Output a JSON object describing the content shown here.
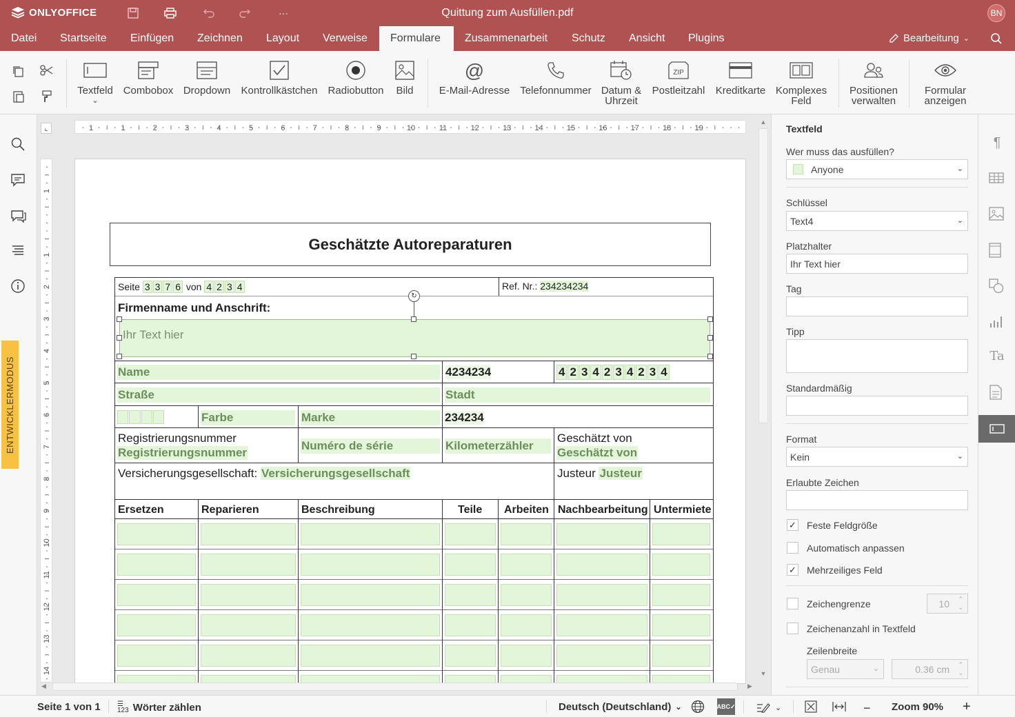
{
  "app": {
    "name": "ONLYOFFICE",
    "doc_title": "Quittung zum Ausfüllen.pdf",
    "user_initials": "BN"
  },
  "menu": {
    "items": [
      "Datei",
      "Startseite",
      "Einfügen",
      "Zeichnen",
      "Layout",
      "Verweise",
      "Formulare",
      "Zusammenarbeit",
      "Schutz",
      "Ansicht",
      "Plugins"
    ],
    "active": "Formulare",
    "edit_mode": "Bearbeitung"
  },
  "ribbon": {
    "textfield": "Textfeld",
    "combobox": "Combobox",
    "dropdown": "Dropdown",
    "checkbox": "Kontrollkästchen",
    "radio": "Radiobutton",
    "image": "Bild",
    "email": "E-Mail-Adresse",
    "phone": "Telefonnummer",
    "date_l1": "Datum &",
    "date_l2": "Uhrzeit",
    "zip": "Postleitzahl",
    "credit": "Kreditkarte",
    "complex_l1": "Komplexes",
    "complex_l2": "Feld",
    "roles_l1": "Positionen",
    "roles_l2": "verwalten",
    "view_l1": "Formular",
    "view_l2": "anzeigen"
  },
  "left": {
    "devmode": "ENTWICKLERMODUS"
  },
  "ruler": {
    "h_labels": [
      "1",
      "1",
      "2",
      "3",
      "4",
      "5",
      "6",
      "7",
      "8",
      "9",
      "10",
      "11",
      "12",
      "13",
      "14",
      "15",
      "16",
      "17",
      "18",
      "19"
    ],
    "v_labels": [
      "1",
      "1",
      "2",
      "3",
      "4",
      "5",
      "6",
      "7",
      "8",
      "9",
      "10",
      "11",
      "12",
      "13",
      "14"
    ]
  },
  "form": {
    "title": "Geschätzte Autoreparaturen",
    "page_label": "Seite",
    "page_digits": [
      "3",
      "3",
      "7",
      "6"
    ],
    "of_label": "von",
    "of_digits": [
      "4",
      "2",
      "3",
      "4"
    ],
    "ref_label": "Ref. Nr.:",
    "ref_value": "234234234",
    "company_label": "Firmenname und Anschrift:",
    "company_placeholder": "Ihr Text hier",
    "name": "Name",
    "name_value": "4234234",
    "name_digits": [
      "4",
      "2",
      "3",
      "4",
      "2",
      "3",
      "4",
      "2",
      "3",
      "4"
    ],
    "street": "Straße",
    "city": "Stadt",
    "color": "Farbe",
    "brand": "Marke",
    "brand_value": "234234",
    "reg_label": "Registrierungsnummer",
    "reg_field": "Registrierungsnummer",
    "serial": "Numéro de série",
    "km": "Kilometerzähler",
    "est_label": "Geschätzt von",
    "est_field": "Geschätzt von",
    "ins_label": "Versicherungsgesellschaft:",
    "ins_field": "Versicherungsgesellschaft",
    "adj_label": "Justeur",
    "adj_field": "Justeur",
    "cols": [
      "Ersetzen",
      "Reparieren",
      "Beschreibung",
      "Teile",
      "Arbeiten",
      "Nachbearbeitung",
      "Untermiete"
    ]
  },
  "panel": {
    "title": "Textfeld",
    "who_label": "Wer muss das ausfüllen?",
    "who_value": "Anyone",
    "key_label": "Schlüssel",
    "key_value": "Text4",
    "placeholder_label": "Platzhalter",
    "placeholder_value": "Ihr Text hier",
    "tag_label": "Tag",
    "tip_label": "Tipp",
    "default_label": "Standardmäßig",
    "format_label": "Format",
    "format_value": "Kein",
    "allowed_label": "Erlaubte Zeichen",
    "fixed_size": "Feste Feldgröße",
    "fixed_size_checked": true,
    "autofit": "Automatisch anpassen",
    "autofit_checked": false,
    "multiline": "Mehrzeiliges Feld",
    "multiline_checked": true,
    "charlimit": "Zeichengrenze",
    "charlimit_value": "10",
    "charlimit_checked": false,
    "comb": "Zeichenanzahl in Textfeld",
    "comb_checked": false,
    "cell_width_label": "Zeilenbreite",
    "cell_width_mode": "Genau",
    "cell_width_value": "0.36 cm"
  },
  "status": {
    "page": "Seite 1 von 1",
    "words": "Wörter zählen",
    "lang": "Deutsch (Deutschland)",
    "zoom": "Zoom 90%"
  }
}
